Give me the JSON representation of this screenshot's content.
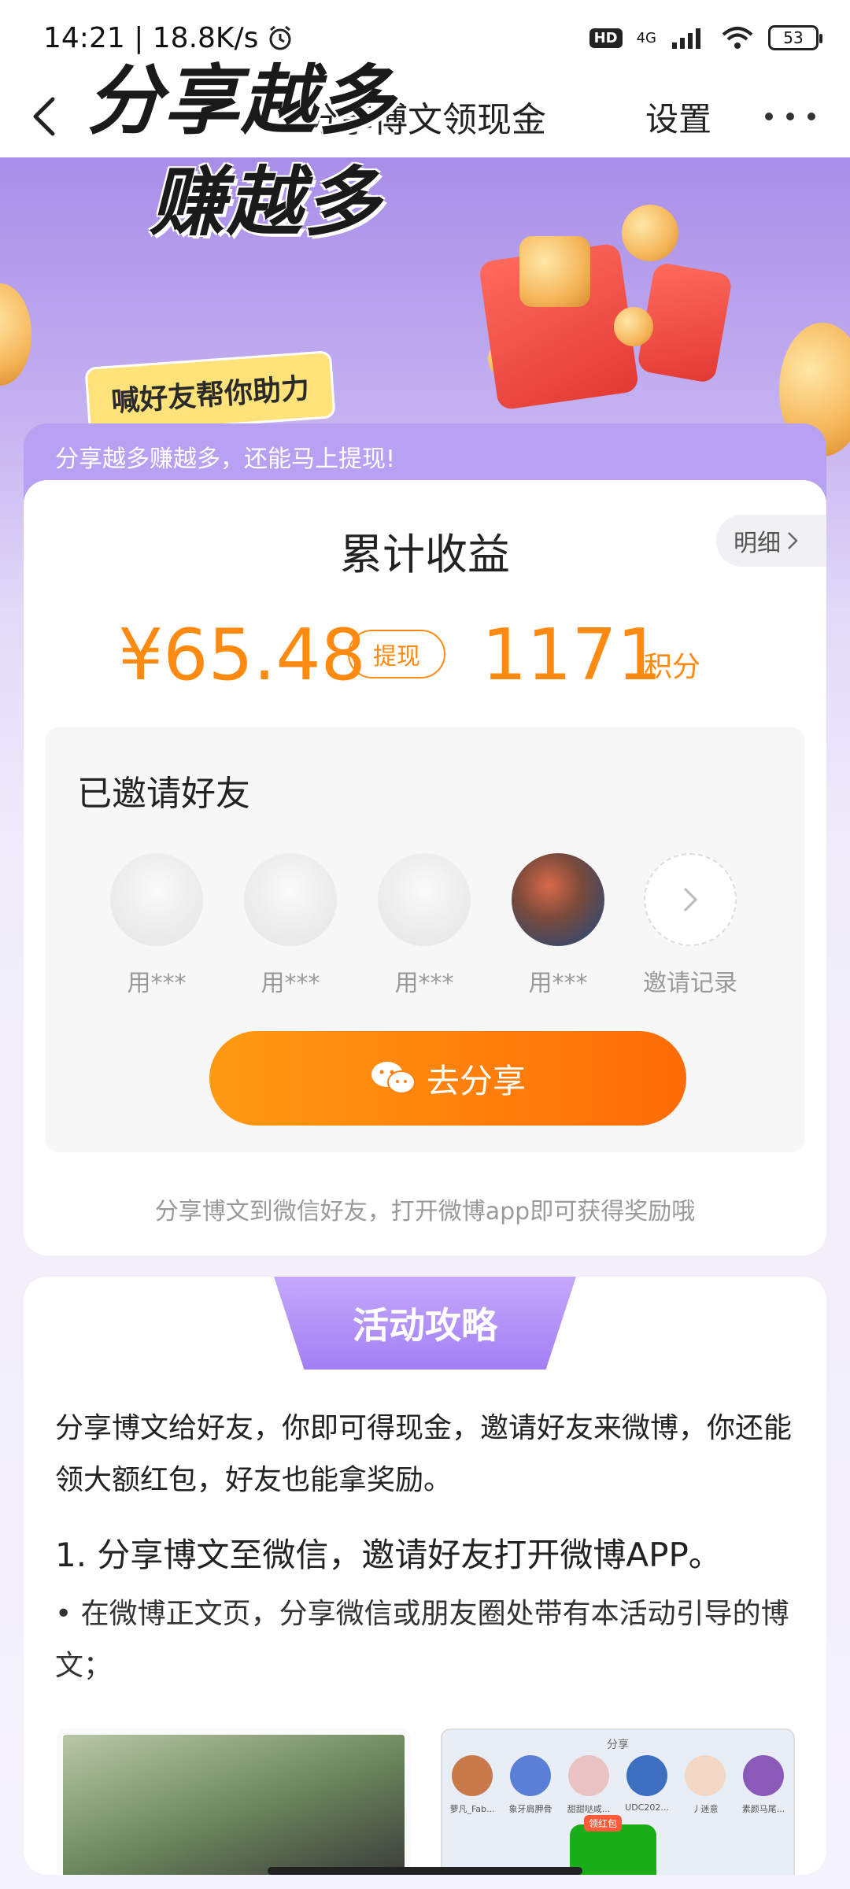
{
  "status_bar": {
    "time_speed": "14:21 | 18.8K/s",
    "network": "4G",
    "hd": "HD",
    "battery": "53"
  },
  "nav": {
    "title": "分享博文领现金",
    "settings": "设置"
  },
  "banner": {
    "line1": "分享越多",
    "line2": "赚越多",
    "pill": "喊好友帮你助力"
  },
  "earnings": {
    "header_text": "分享越多赚越多，还能马上提现!",
    "title": "累计收益",
    "detail_label": "明细",
    "money": "¥65.48",
    "withdraw_label": "提现",
    "points": "1171",
    "points_unit": "积分",
    "friends_title": "已邀请好友",
    "friends": [
      {
        "name": "用***"
      },
      {
        "name": "用***"
      },
      {
        "name": "用***"
      },
      {
        "name": "用***"
      }
    ],
    "invite_record_label": "邀请记录",
    "share_label": "去分享",
    "share_note": "分享博文到微信好友，打开微博app即可获得奖励哦"
  },
  "guide": {
    "tab": "活动攻略",
    "intro": "分享博文给好友，你即可得现金，邀请好友来微博，你还能领大额红包，好友也能拿奖励。",
    "step1": "1. 分享博文至微信，邀请好友打开微博APP。",
    "bullet1": "• 在微博正文页，分享微信或朋友圈处带有本活动引导的博文；",
    "shot_right": {
      "share_label": "分享",
      "names": [
        "萝凡_Fab...",
        "象牙肩胛骨",
        "甜甜哒咸...",
        "UDC202...",
        "丿迷意",
        "素颜马尾..."
      ],
      "red_tag": "领红包"
    }
  }
}
